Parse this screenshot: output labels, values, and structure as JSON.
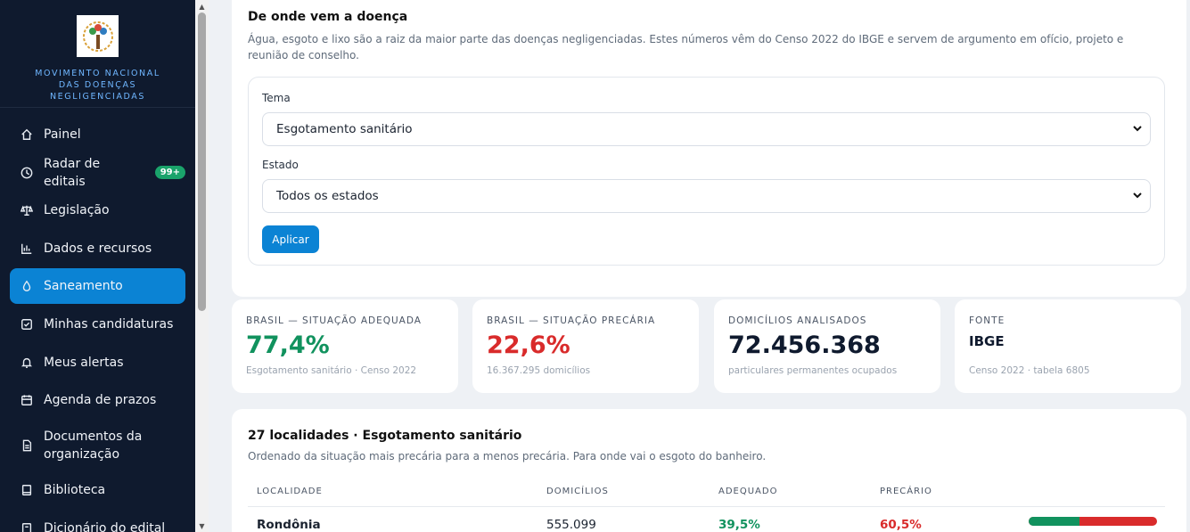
{
  "sidebar": {
    "brand": "MOVIMENTO NACIONAL DAS DOENÇAS NEGLIGENCIADAS",
    "items": [
      {
        "label": "Painel",
        "icon": "home-icon"
      },
      {
        "label": "Radar de editais",
        "icon": "clock-icon",
        "badge": "99+"
      },
      {
        "label": "Legislação",
        "icon": "scale-icon"
      },
      {
        "label": "Dados e recursos",
        "icon": "bar-chart-icon"
      },
      {
        "label": "Saneamento",
        "icon": "droplet-icon",
        "active": true
      },
      {
        "label": "Minhas candidaturas",
        "icon": "checkbox-icon"
      },
      {
        "label": "Meus alertas",
        "icon": "bell-icon"
      },
      {
        "label": "Agenda de prazos",
        "icon": "calendar-icon"
      },
      {
        "label": "Documentos da organização",
        "icon": "document-icon"
      },
      {
        "label": "Biblioteca",
        "icon": "book-icon"
      },
      {
        "label": "Dicionário do edital",
        "icon": "dictionary-icon"
      }
    ]
  },
  "filter": {
    "title": "De onde vem a doença",
    "description": "Água, esgoto e lixo são a raiz da maior parte das doenças negligenciadas. Estes números vêm do Censo 2022 do IBGE e servem de argumento em ofício, projeto e reunião de conselho.",
    "tema_label": "Tema",
    "tema_value": "Esgotamento sanitário",
    "estado_label": "Estado",
    "estado_value": "Todos os estados",
    "apply_label": "Aplicar"
  },
  "stats": [
    {
      "label": "Brasil — situação adequada",
      "value": "77,4%",
      "sub": "Esgotamento sanitário · Censo 2022",
      "color": "#11925e"
    },
    {
      "label": "Brasil — situação precária",
      "value": "22,6%",
      "sub": "16.367.295 domicílios",
      "color": "#d92b2b"
    },
    {
      "label": "Domicílios analisados",
      "value": "72.456.368",
      "sub": "particulares permanentes ocupados",
      "color": "#0f1a2e"
    },
    {
      "label": "Fonte",
      "value": "IBGE",
      "sub": "Censo 2022 · tabela 6805",
      "color": "#0f1a2e"
    }
  ],
  "table": {
    "title": "27 localidades · Esgotamento sanitário",
    "description": "Ordenado da situação mais precária para a menos precária. Para onde vai o esgoto do banheiro.",
    "headers": [
      "Localidade",
      "Domicílios",
      "Adequado",
      "Precário"
    ],
    "rows": [
      {
        "localidade": "Rondônia",
        "domicilios": "555.099",
        "adequado": "39,5%",
        "precario": "60,5%",
        "adequado_fraction": 0.395
      }
    ]
  },
  "colors": {
    "accent": "#0b83d4",
    "good": "#11925e",
    "bad": "#d92b2b",
    "sidebar": "#0f1a2e"
  }
}
